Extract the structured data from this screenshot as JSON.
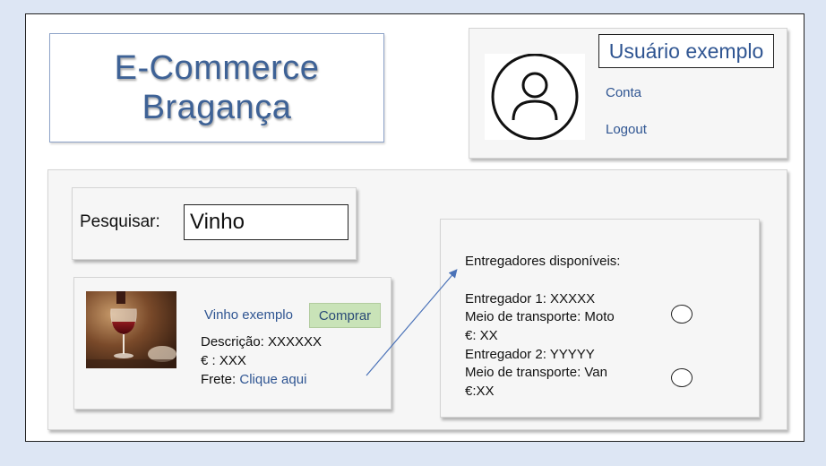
{
  "header": {
    "logo_text": "E-Commerce\nBragança"
  },
  "user": {
    "name": "Usuário exemplo",
    "account_link": "Conta",
    "logout_link": "Logout",
    "avatar_icon": "user-circle-icon"
  },
  "search": {
    "label": "Pesquisar:",
    "value": "Vinho"
  },
  "product": {
    "name": "Vinho exemplo",
    "buy_label": "Comprar",
    "description": "Descrição: XXXXXX",
    "price": "€ :  XXX",
    "shipping_label": "Frete: ",
    "shipping_link": "Clique aqui",
    "image": "red-wine-glass-photo"
  },
  "couriers": {
    "title": "Entregadores disponíveis:",
    "items": [
      {
        "name": "Entregador 1: XXXXX",
        "transport": "Meio de transporte: Moto",
        "price": "€: XX",
        "selected": false
      },
      {
        "name": "Entregador 2: YYYYY",
        "transport": "Meio de transporte: Van",
        "price": "€:XX",
        "selected": false
      }
    ]
  },
  "colors": {
    "background": "#dde6f4",
    "accent_blue": "#2f5592",
    "buy_button": "#c9e3b8",
    "arrow": "#4a72b8"
  }
}
